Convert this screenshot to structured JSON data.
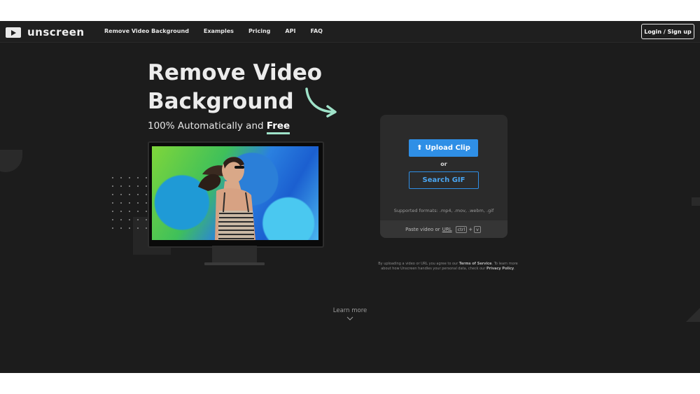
{
  "brand": {
    "name": "unscreen",
    "icon": "play-window-icon"
  },
  "nav": {
    "links": [
      "Remove Video Background",
      "Examples",
      "Pricing",
      "API",
      "FAQ"
    ],
    "login_label": "Login / Sign up"
  },
  "hero": {
    "title_line1": "Remove Video",
    "title_line2": "Background",
    "subtitle_prefix": "100% Automatically and ",
    "subtitle_emphasis": "Free"
  },
  "upload_panel": {
    "upload_label": "Upload Clip",
    "or_label": "or",
    "search_label": "Search GIF",
    "formats": "Supported formats: .mp4, .mov, .webm, .gif",
    "paste_prefix": "Paste video or",
    "paste_link": "URL",
    "key_ctrl": "ctrl",
    "key_plus": "+",
    "key_v": "v"
  },
  "terms": {
    "part1": "By uploading a video or URL you agree to our ",
    "tos": "Terms of Service",
    "part2": ". To learn more about how Unscreen handles your personal data, check our ",
    "privacy": "Privacy Policy",
    "part3": "."
  },
  "learn_more": {
    "label": "Learn more",
    "icon": "chevron-down-icon"
  },
  "colors": {
    "accent": "#2f8fe6",
    "highlight": "#9fe3c9",
    "background": "#1c1c1c"
  }
}
